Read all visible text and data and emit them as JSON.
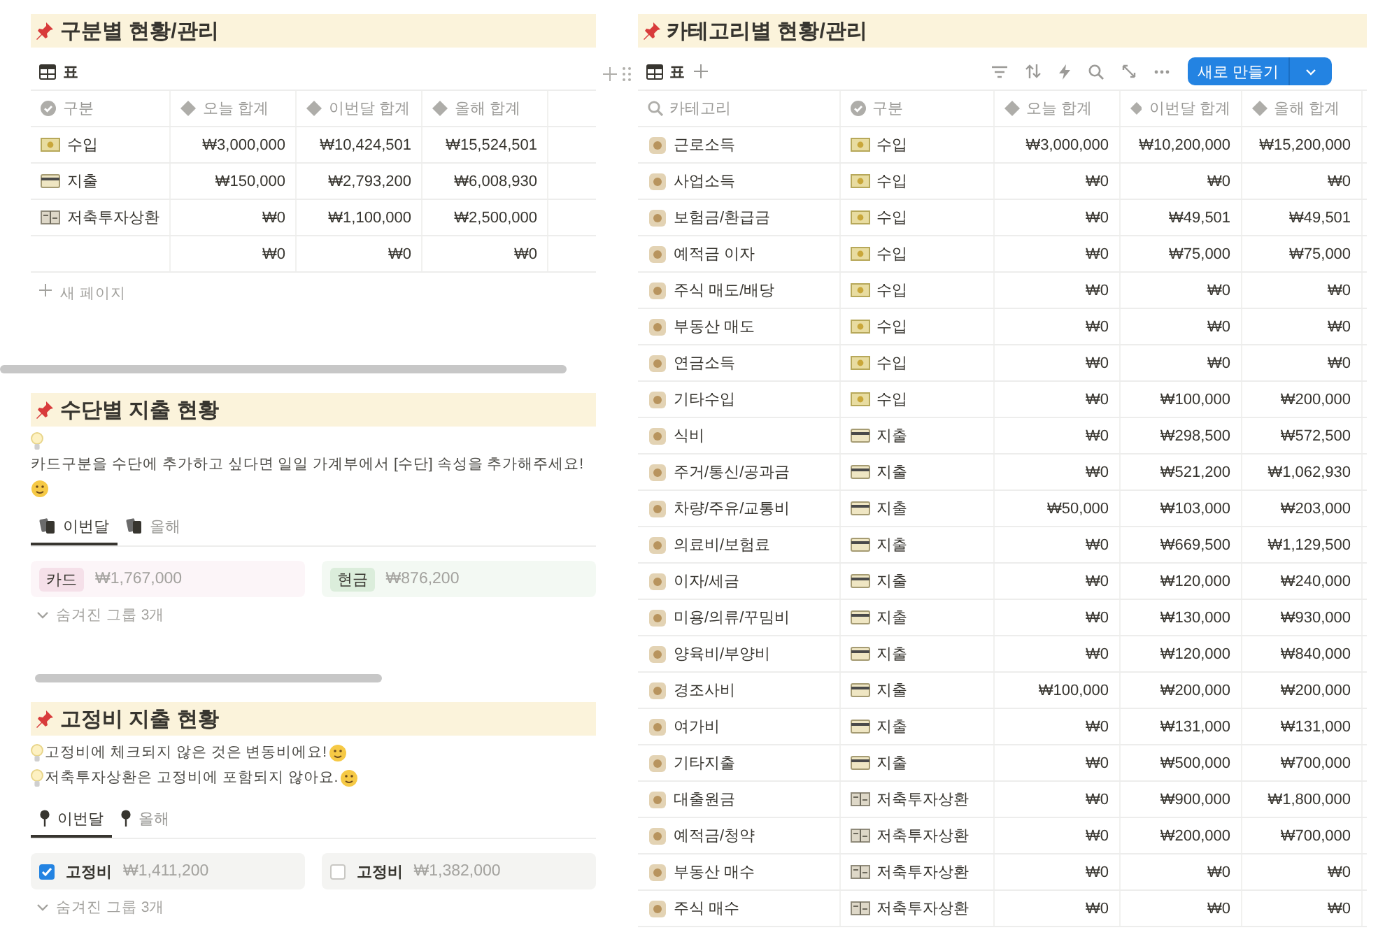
{
  "status_section": {
    "title": "구분별 현황/관리",
    "views": [
      {
        "label": "표",
        "selected": true
      }
    ],
    "columns": [
      "구분",
      "오늘 합계",
      "이번달 합계",
      "올해 합계"
    ],
    "rows": [
      {
        "kind": "income",
        "type": "수입",
        "today": "₩3,000,000",
        "month": "₩10,424,501",
        "year": "₩15,524,501"
      },
      {
        "kind": "expense",
        "type": "지출",
        "today": "₩150,000",
        "month": "₩2,793,200",
        "year": "₩6,008,930"
      },
      {
        "kind": "saving",
        "type": "저축투자상환",
        "today": "₩0",
        "month": "₩1,100,000",
        "year": "₩2,500,000"
      },
      {
        "kind": "none",
        "today": "₩0",
        "month": "₩0",
        "year": "₩0"
      }
    ],
    "new_page": "새 페이지"
  },
  "method_section": {
    "title": "수단별 지출 현황",
    "notes": [
      "카드구분을 수단에 추가하고 싶다면 일일 가계부에서 [수단] 속성을 추가해주세요!"
    ],
    "tabs": [
      {
        "label": "이번달",
        "selected": true
      },
      {
        "label": "올해",
        "selected": false
      }
    ],
    "groups": [
      {
        "label": "카드",
        "amount": "₩1,767,000",
        "color": "#f5e0e9"
      },
      {
        "label": "현금",
        "amount": "₩876,200",
        "color": "#dbeddb"
      }
    ],
    "hidden_groups": "숨겨진 그룹 3개"
  },
  "fixed_section": {
    "title": "고정비 지출 현황",
    "notes": [
      "고정비에 체크되지 않은 것은 변동비에요!",
      "저축투자상환은 고정비에 포함되지 않아요."
    ],
    "tabs": [
      {
        "label": "이번달",
        "selected": true
      },
      {
        "label": "올해",
        "selected": false
      }
    ],
    "groups": [
      {
        "label": "고정비",
        "checked": true,
        "amount": "₩1,411,200"
      },
      {
        "label": "고정비",
        "checked": false,
        "amount": "₩1,382,000"
      }
    ],
    "hidden_groups": "숨겨진 그룹 3개"
  },
  "category_section": {
    "title": "카테고리별 현황/관리",
    "views": [
      {
        "label": "표",
        "selected": true
      }
    ],
    "new_button": "새로 만들기",
    "columns": [
      "카테고리",
      "구분",
      "오늘 합계",
      "이번달 합계",
      "올해 합계"
    ],
    "rows": [
      {
        "category": "근로소득",
        "kind": "income",
        "type": "수입",
        "today": "₩3,000,000",
        "month": "₩10,200,000",
        "year": "₩15,200,000"
      },
      {
        "category": "사업소득",
        "kind": "income",
        "type": "수입",
        "today": "₩0",
        "month": "₩0",
        "year": "₩0"
      },
      {
        "category": "보험금/환급금",
        "kind": "income",
        "type": "수입",
        "today": "₩0",
        "month": "₩49,501",
        "year": "₩49,501"
      },
      {
        "category": "예적금 이자",
        "kind": "income",
        "type": "수입",
        "today": "₩0",
        "month": "₩75,000",
        "year": "₩75,000"
      },
      {
        "category": "주식 매도/배당",
        "kind": "income",
        "type": "수입",
        "today": "₩0",
        "month": "₩0",
        "year": "₩0"
      },
      {
        "category": "부동산 매도",
        "kind": "income",
        "type": "수입",
        "today": "₩0",
        "month": "₩0",
        "year": "₩0"
      },
      {
        "category": "연금소득",
        "kind": "income",
        "type": "수입",
        "today": "₩0",
        "month": "₩0",
        "year": "₩0"
      },
      {
        "category": "기타수입",
        "kind": "income",
        "type": "수입",
        "today": "₩0",
        "month": "₩100,000",
        "year": "₩200,000"
      },
      {
        "category": "식비",
        "kind": "expense",
        "type": "지출",
        "today": "₩0",
        "month": "₩298,500",
        "year": "₩572,500"
      },
      {
        "category": "주거/통신/공과금",
        "kind": "expense",
        "type": "지출",
        "today": "₩0",
        "month": "₩521,200",
        "year": "₩1,062,930"
      },
      {
        "category": "차량/주유/교통비",
        "kind": "expense",
        "type": "지출",
        "today": "₩50,000",
        "month": "₩103,000",
        "year": "₩203,000"
      },
      {
        "category": "의료비/보험료",
        "kind": "expense",
        "type": "지출",
        "today": "₩0",
        "month": "₩669,500",
        "year": "₩1,129,500"
      },
      {
        "category": "이자/세금",
        "kind": "expense",
        "type": "지출",
        "today": "₩0",
        "month": "₩120,000",
        "year": "₩240,000"
      },
      {
        "category": "미용/의류/꾸밈비",
        "kind": "expense",
        "type": "지출",
        "today": "₩0",
        "month": "₩130,000",
        "year": "₩930,000"
      },
      {
        "category": "양육비/부양비",
        "kind": "expense",
        "type": "지출",
        "today": "₩0",
        "month": "₩120,000",
        "year": "₩840,000"
      },
      {
        "category": "경조사비",
        "kind": "expense",
        "type": "지출",
        "today": "₩100,000",
        "month": "₩200,000",
        "year": "₩200,000"
      },
      {
        "category": "여가비",
        "kind": "expense",
        "type": "지출",
        "today": "₩0",
        "month": "₩131,000",
        "year": "₩131,000"
      },
      {
        "category": "기타지출",
        "kind": "expense",
        "type": "지출",
        "today": "₩0",
        "month": "₩500,000",
        "year": "₩700,000"
      },
      {
        "category": "대출원금",
        "kind": "saving",
        "type": "저축투자상환",
        "today": "₩0",
        "month": "₩900,000",
        "year": "₩1,800,000"
      },
      {
        "category": "예적금/청약",
        "kind": "saving",
        "type": "저축투자상환",
        "today": "₩0",
        "month": "₩200,000",
        "year": "₩700,000"
      },
      {
        "category": "부동산 매수",
        "kind": "saving",
        "type": "저축투자상환",
        "today": "₩0",
        "month": "₩0",
        "year": "₩0"
      },
      {
        "category": "주식 매수",
        "kind": "saving",
        "type": "저축투자상환",
        "today": "₩0",
        "month": "₩0",
        "year": "₩0"
      }
    ]
  }
}
